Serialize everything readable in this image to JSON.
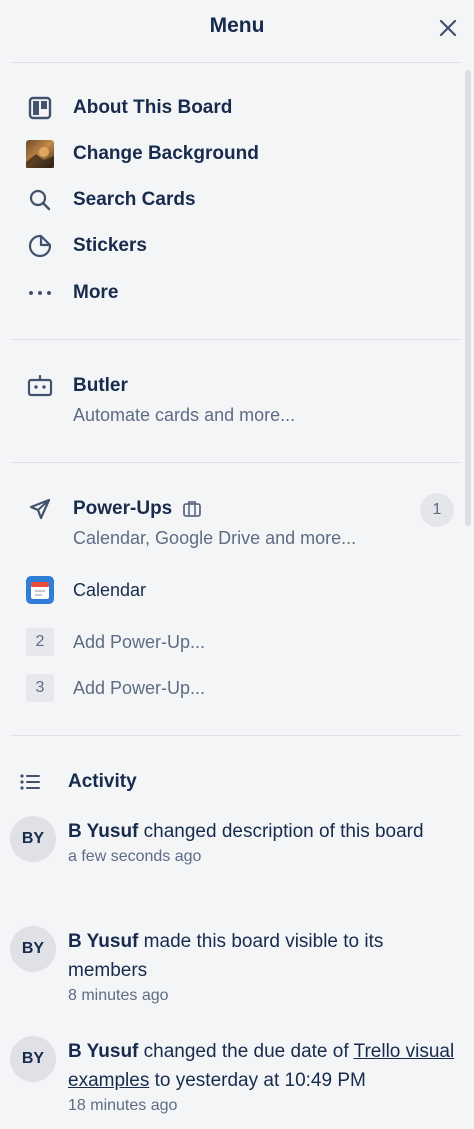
{
  "header": {
    "title": "Menu"
  },
  "menu_items": [
    {
      "label": "About This Board",
      "icon": "board-icon"
    },
    {
      "label": "Change Background",
      "icon": "background-thumbnail"
    },
    {
      "label": "Search Cards",
      "icon": "search-icon"
    },
    {
      "label": "Stickers",
      "icon": "sticker-icon"
    },
    {
      "label": "More",
      "icon": "more-icon"
    }
  ],
  "butler": {
    "title": "Butler",
    "subtitle": "Automate cards and more..."
  },
  "powerups": {
    "title": "Power-Ups",
    "subtitle": "Calendar, Google Drive and more...",
    "count": "1",
    "calendar_label": "Calendar",
    "slots": [
      {
        "number": "2",
        "label": "Add Power-Up..."
      },
      {
        "number": "3",
        "label": "Add Power-Up..."
      }
    ]
  },
  "activity": {
    "title": "Activity",
    "entries": [
      {
        "avatar": "BY",
        "user": "B Yusuf",
        "action": " changed description of this board",
        "time": "a few seconds ago"
      },
      {
        "avatar": "BY",
        "user": "B Yusuf",
        "action": " made this board visible to its members",
        "time": "8 minutes ago"
      },
      {
        "avatar": "BY",
        "user": "B Yusuf",
        "action_before": " changed the due date of ",
        "link": "Trello visual examples",
        "action_after": " to yesterday at 10:49 PM",
        "time": "18 minutes ago"
      }
    ]
  }
}
